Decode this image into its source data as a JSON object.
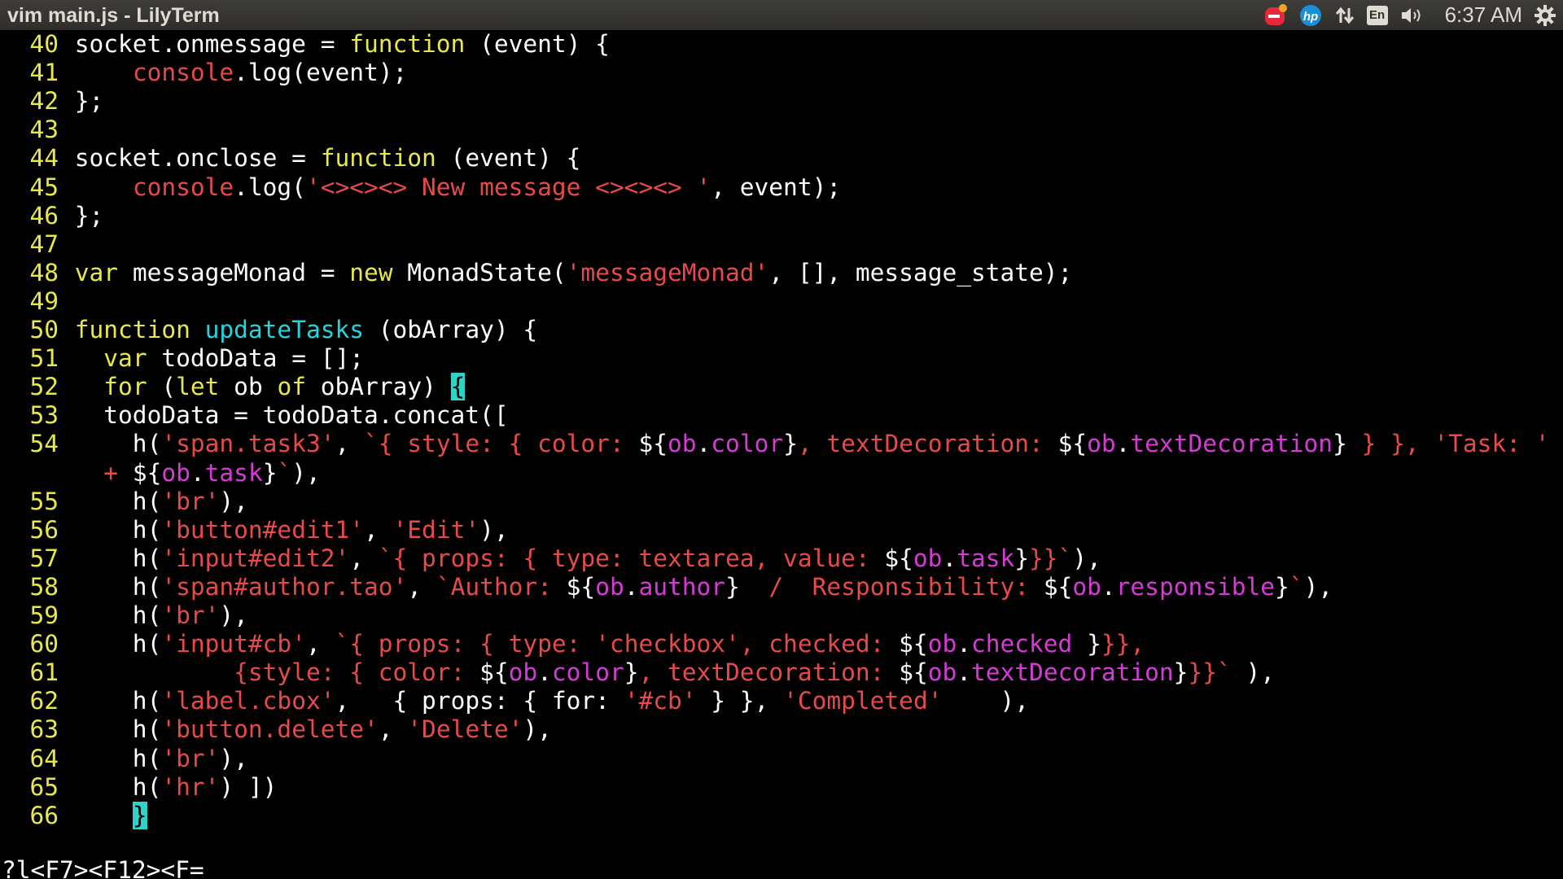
{
  "window": {
    "title": "vim main.js - LilyTerm"
  },
  "tray": {
    "lang": "En",
    "clock": "6:37 AM",
    "icons": [
      "notification-icon",
      "hp-icon",
      "network-arrows-icon",
      "keyboard-language-icon",
      "volume-icon",
      "gear-icon"
    ]
  },
  "editor": {
    "lines": [
      {
        "no": "40",
        "parts": [
          [
            "socket.onmessage = ",
            ""
          ],
          [
            "function",
            "k"
          ],
          [
            " (event) {",
            ""
          ]
        ]
      },
      {
        "no": "41",
        "parts": [
          [
            "    ",
            ""
          ],
          [
            "console",
            "c"
          ],
          [
            ".log(event);",
            ""
          ]
        ]
      },
      {
        "no": "42",
        "parts": [
          [
            "};",
            ""
          ]
        ]
      },
      {
        "no": "43",
        "parts": []
      },
      {
        "no": "44",
        "parts": [
          [
            "socket.onclose = ",
            ""
          ],
          [
            "function",
            "k"
          ],
          [
            " (event) {",
            ""
          ]
        ]
      },
      {
        "no": "45",
        "parts": [
          [
            "    ",
            ""
          ],
          [
            "console",
            "c"
          ],
          [
            ".log(",
            ""
          ],
          [
            "'<><><> New message <><><> '",
            "s"
          ],
          [
            ", event);",
            ""
          ]
        ]
      },
      {
        "no": "46",
        "parts": [
          [
            "};",
            ""
          ]
        ]
      },
      {
        "no": "47",
        "parts": []
      },
      {
        "no": "48",
        "parts": [
          [
            "var",
            "k"
          ],
          [
            " messageMonad = ",
            ""
          ],
          [
            "new",
            "k"
          ],
          [
            " MonadState(",
            ""
          ],
          [
            "'messageMonad'",
            "s"
          ],
          [
            ", [], message_state);",
            ""
          ]
        ]
      },
      {
        "no": "49",
        "parts": []
      },
      {
        "no": "50",
        "parts": [
          [
            "function",
            "k"
          ],
          [
            " ",
            ""
          ],
          [
            "updateTasks",
            "f"
          ],
          [
            " (obArray) {",
            ""
          ]
        ]
      },
      {
        "no": "51",
        "parts": [
          [
            "  ",
            ""
          ],
          [
            "var",
            "k"
          ],
          [
            " todoData = [];",
            ""
          ]
        ]
      },
      {
        "no": "52",
        "parts": [
          [
            "  ",
            ""
          ],
          [
            "for",
            "k"
          ],
          [
            " (",
            ""
          ],
          [
            "let",
            "k"
          ],
          [
            " ob ",
            ""
          ],
          [
            "of",
            "k"
          ],
          [
            " obArray) ",
            ""
          ],
          [
            "{",
            "cursor-brace"
          ]
        ]
      },
      {
        "no": "53",
        "parts": [
          [
            "  todoData = todoData.concat([",
            ""
          ]
        ]
      },
      {
        "no": "54",
        "parts": [
          [
            "    h(",
            ""
          ],
          [
            "'span.task3'",
            "s"
          ],
          [
            ", ",
            ""
          ],
          [
            "`{ style: { color: ",
            "s"
          ],
          [
            "${",
            ""
          ],
          [
            "ob",
            "m"
          ],
          [
            ".",
            ""
          ],
          [
            "color",
            "m"
          ],
          [
            "}",
            ""
          ],
          [
            ", textDecoration: ",
            "s"
          ],
          [
            "${",
            ""
          ],
          [
            "ob",
            "m"
          ],
          [
            ".",
            ""
          ],
          [
            "textDecoration",
            "m"
          ],
          [
            "}",
            ""
          ],
          [
            " } }, 'Task: '",
            "s"
          ]
        ]
      },
      {
        "no": "",
        "parts": [
          [
            "  ",
            ""
          ],
          [
            "+",
            "s"
          ],
          [
            " ${",
            ""
          ],
          [
            "ob",
            "m"
          ],
          [
            ".",
            ""
          ],
          [
            "task",
            "m"
          ],
          [
            "}",
            ""
          ],
          [
            "`",
            "s"
          ],
          [
            "),",
            ""
          ]
        ]
      },
      {
        "no": "55",
        "parts": [
          [
            "    h(",
            ""
          ],
          [
            "'br'",
            "s"
          ],
          [
            "),",
            ""
          ]
        ]
      },
      {
        "no": "56",
        "parts": [
          [
            "    h(",
            ""
          ],
          [
            "'button#edit1'",
            "s"
          ],
          [
            ", ",
            ""
          ],
          [
            "'Edit'",
            "s"
          ],
          [
            "),",
            ""
          ]
        ]
      },
      {
        "no": "57",
        "parts": [
          [
            "    h(",
            ""
          ],
          [
            "'input#edit2'",
            "s"
          ],
          [
            ", ",
            ""
          ],
          [
            "`{ props: { type: textarea, value: ",
            "s"
          ],
          [
            "${",
            ""
          ],
          [
            "ob",
            "m"
          ],
          [
            ".",
            ""
          ],
          [
            "task",
            "m"
          ],
          [
            "}",
            ""
          ],
          [
            "}}`",
            "s"
          ],
          [
            "),",
            ""
          ]
        ]
      },
      {
        "no": "58",
        "parts": [
          [
            "    h(",
            ""
          ],
          [
            "'span#author.tao'",
            "s"
          ],
          [
            ", ",
            ""
          ],
          [
            "`Author: ",
            "s"
          ],
          [
            "${",
            ""
          ],
          [
            "ob",
            "m"
          ],
          [
            ".",
            ""
          ],
          [
            "author",
            "m"
          ],
          [
            "}",
            ""
          ],
          [
            "  /  Responsibility: ",
            "s"
          ],
          [
            "${",
            ""
          ],
          [
            "ob",
            "m"
          ],
          [
            ".",
            ""
          ],
          [
            "responsible",
            "m"
          ],
          [
            "}",
            ""
          ],
          [
            "`",
            "s"
          ],
          [
            "),",
            ""
          ]
        ]
      },
      {
        "no": "59",
        "parts": [
          [
            "    h(",
            ""
          ],
          [
            "'br'",
            "s"
          ],
          [
            "),",
            ""
          ]
        ]
      },
      {
        "no": "60",
        "parts": [
          [
            "    h(",
            ""
          ],
          [
            "'input#cb'",
            "s"
          ],
          [
            ", ",
            ""
          ],
          [
            "`{ props: { type: 'checkbox', checked: ",
            "s"
          ],
          [
            "${",
            ""
          ],
          [
            "ob",
            "m"
          ],
          [
            ".",
            ""
          ],
          [
            "checked",
            "m"
          ],
          [
            " }",
            ""
          ],
          [
            "}},",
            "s"
          ]
        ]
      },
      {
        "no": "61",
        "parts": [
          [
            "           ",
            ""
          ],
          [
            "{style: { color: ",
            "s"
          ],
          [
            "${",
            ""
          ],
          [
            "ob",
            "m"
          ],
          [
            ".",
            ""
          ],
          [
            "color",
            "m"
          ],
          [
            "}",
            ""
          ],
          [
            ", textDecoration: ",
            "s"
          ],
          [
            "${",
            ""
          ],
          [
            "ob",
            "m"
          ],
          [
            ".",
            ""
          ],
          [
            "textDecoration",
            "m"
          ],
          [
            "}",
            ""
          ],
          [
            "}}`",
            "s"
          ],
          [
            " ),",
            ""
          ]
        ]
      },
      {
        "no": "62",
        "parts": [
          [
            "    h(",
            ""
          ],
          [
            "'label.cbox'",
            "s"
          ],
          [
            ",   { props: { for: ",
            ""
          ],
          [
            "'#cb'",
            "s"
          ],
          [
            " } }, ",
            ""
          ],
          [
            "'Completed'",
            "s"
          ],
          [
            "    ),",
            ""
          ]
        ]
      },
      {
        "no": "63",
        "parts": [
          [
            "    h(",
            ""
          ],
          [
            "'button.delete'",
            "s"
          ],
          [
            ", ",
            ""
          ],
          [
            "'Delete'",
            "s"
          ],
          [
            "),",
            ""
          ]
        ]
      },
      {
        "no": "64",
        "parts": [
          [
            "    h(",
            ""
          ],
          [
            "'br'",
            "s"
          ],
          [
            "),",
            ""
          ]
        ]
      },
      {
        "no": "65",
        "parts": [
          [
            "    h(",
            ""
          ],
          [
            "'hr'",
            "s"
          ],
          [
            ") ])",
            ""
          ]
        ]
      },
      {
        "no": "66",
        "parts": [
          [
            "    ",
            ""
          ],
          [
            "}",
            "cursor-brace"
          ]
        ]
      }
    ],
    "command_line": "?l<F7><F12><F=",
    "command_cursor": "_"
  }
}
